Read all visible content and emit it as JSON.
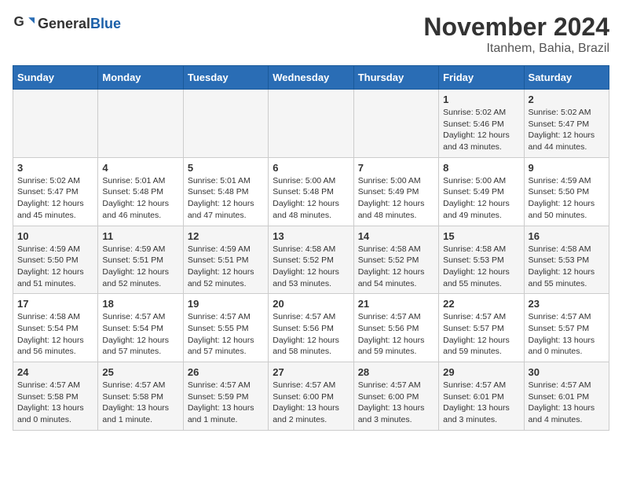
{
  "logo": {
    "general": "General",
    "blue": "Blue"
  },
  "title": "November 2024",
  "subtitle": "Itanhem, Bahia, Brazil",
  "days_of_week": [
    "Sunday",
    "Monday",
    "Tuesday",
    "Wednesday",
    "Thursday",
    "Friday",
    "Saturday"
  ],
  "weeks": [
    [
      {
        "day": "",
        "info": ""
      },
      {
        "day": "",
        "info": ""
      },
      {
        "day": "",
        "info": ""
      },
      {
        "day": "",
        "info": ""
      },
      {
        "day": "",
        "info": ""
      },
      {
        "day": "1",
        "info": "Sunrise: 5:02 AM\nSunset: 5:46 PM\nDaylight: 12 hours\nand 43 minutes."
      },
      {
        "day": "2",
        "info": "Sunrise: 5:02 AM\nSunset: 5:47 PM\nDaylight: 12 hours\nand 44 minutes."
      }
    ],
    [
      {
        "day": "3",
        "info": "Sunrise: 5:02 AM\nSunset: 5:47 PM\nDaylight: 12 hours\nand 45 minutes."
      },
      {
        "day": "4",
        "info": "Sunrise: 5:01 AM\nSunset: 5:48 PM\nDaylight: 12 hours\nand 46 minutes."
      },
      {
        "day": "5",
        "info": "Sunrise: 5:01 AM\nSunset: 5:48 PM\nDaylight: 12 hours\nand 47 minutes."
      },
      {
        "day": "6",
        "info": "Sunrise: 5:00 AM\nSunset: 5:48 PM\nDaylight: 12 hours\nand 48 minutes."
      },
      {
        "day": "7",
        "info": "Sunrise: 5:00 AM\nSunset: 5:49 PM\nDaylight: 12 hours\nand 48 minutes."
      },
      {
        "day": "8",
        "info": "Sunrise: 5:00 AM\nSunset: 5:49 PM\nDaylight: 12 hours\nand 49 minutes."
      },
      {
        "day": "9",
        "info": "Sunrise: 4:59 AM\nSunset: 5:50 PM\nDaylight: 12 hours\nand 50 minutes."
      }
    ],
    [
      {
        "day": "10",
        "info": "Sunrise: 4:59 AM\nSunset: 5:50 PM\nDaylight: 12 hours\nand 51 minutes."
      },
      {
        "day": "11",
        "info": "Sunrise: 4:59 AM\nSunset: 5:51 PM\nDaylight: 12 hours\nand 52 minutes."
      },
      {
        "day": "12",
        "info": "Sunrise: 4:59 AM\nSunset: 5:51 PM\nDaylight: 12 hours\nand 52 minutes."
      },
      {
        "day": "13",
        "info": "Sunrise: 4:58 AM\nSunset: 5:52 PM\nDaylight: 12 hours\nand 53 minutes."
      },
      {
        "day": "14",
        "info": "Sunrise: 4:58 AM\nSunset: 5:52 PM\nDaylight: 12 hours\nand 54 minutes."
      },
      {
        "day": "15",
        "info": "Sunrise: 4:58 AM\nSunset: 5:53 PM\nDaylight: 12 hours\nand 55 minutes."
      },
      {
        "day": "16",
        "info": "Sunrise: 4:58 AM\nSunset: 5:53 PM\nDaylight: 12 hours\nand 55 minutes."
      }
    ],
    [
      {
        "day": "17",
        "info": "Sunrise: 4:58 AM\nSunset: 5:54 PM\nDaylight: 12 hours\nand 56 minutes."
      },
      {
        "day": "18",
        "info": "Sunrise: 4:57 AM\nSunset: 5:54 PM\nDaylight: 12 hours\nand 57 minutes."
      },
      {
        "day": "19",
        "info": "Sunrise: 4:57 AM\nSunset: 5:55 PM\nDaylight: 12 hours\nand 57 minutes."
      },
      {
        "day": "20",
        "info": "Sunrise: 4:57 AM\nSunset: 5:56 PM\nDaylight: 12 hours\nand 58 minutes."
      },
      {
        "day": "21",
        "info": "Sunrise: 4:57 AM\nSunset: 5:56 PM\nDaylight: 12 hours\nand 59 minutes."
      },
      {
        "day": "22",
        "info": "Sunrise: 4:57 AM\nSunset: 5:57 PM\nDaylight: 12 hours\nand 59 minutes."
      },
      {
        "day": "23",
        "info": "Sunrise: 4:57 AM\nSunset: 5:57 PM\nDaylight: 13 hours\nand 0 minutes."
      }
    ],
    [
      {
        "day": "24",
        "info": "Sunrise: 4:57 AM\nSunset: 5:58 PM\nDaylight: 13 hours\nand 0 minutes."
      },
      {
        "day": "25",
        "info": "Sunrise: 4:57 AM\nSunset: 5:58 PM\nDaylight: 13 hours\nand 1 minute."
      },
      {
        "day": "26",
        "info": "Sunrise: 4:57 AM\nSunset: 5:59 PM\nDaylight: 13 hours\nand 1 minute."
      },
      {
        "day": "27",
        "info": "Sunrise: 4:57 AM\nSunset: 6:00 PM\nDaylight: 13 hours\nand 2 minutes."
      },
      {
        "day": "28",
        "info": "Sunrise: 4:57 AM\nSunset: 6:00 PM\nDaylight: 13 hours\nand 3 minutes."
      },
      {
        "day": "29",
        "info": "Sunrise: 4:57 AM\nSunset: 6:01 PM\nDaylight: 13 hours\nand 3 minutes."
      },
      {
        "day": "30",
        "info": "Sunrise: 4:57 AM\nSunset: 6:01 PM\nDaylight: 13 hours\nand 4 minutes."
      }
    ]
  ]
}
